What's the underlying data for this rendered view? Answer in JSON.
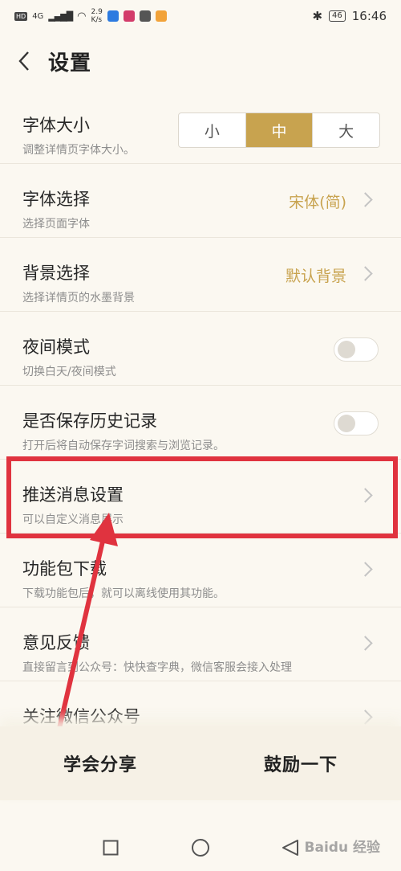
{
  "status_bar": {
    "network": "HD",
    "signal": "4G",
    "speed_value": "2.9",
    "speed_unit": "K/s",
    "battery": "46",
    "time": "16:46"
  },
  "header": {
    "title": "设置"
  },
  "settings": {
    "font_size": {
      "title": "字体大小",
      "subtitle": "调整详情页字体大小。",
      "options": [
        "小",
        "中",
        "大"
      ],
      "selected": "中"
    },
    "font_select": {
      "title": "字体选择",
      "subtitle": "选择页面字体",
      "value": "宋体(简)"
    },
    "background": {
      "title": "背景选择",
      "subtitle": "选择详情页的水墨背景",
      "value": "默认背景"
    },
    "night_mode": {
      "title": "夜间模式",
      "subtitle": "切换白天/夜间模式",
      "enabled": false
    },
    "history": {
      "title": "是否保存历史记录",
      "subtitle": "打开后将自动保存字词搜索与浏览记录。",
      "enabled": false
    },
    "push": {
      "title": "推送消息设置",
      "subtitle": "可以自定义消息展示"
    },
    "package": {
      "title": "功能包下载",
      "subtitle": "下载功能包后，就可以离线使用其功能。"
    },
    "feedback": {
      "title": "意见反馈",
      "subtitle": "直接留言到公众号：快快查字典，微信客服会接入处理"
    },
    "wechat": {
      "title": "关注微信公众号"
    }
  },
  "bottom": {
    "share_label": "学会分享",
    "encourage_label": "鼓励一下"
  },
  "watermark": "Baidu 经验",
  "colors": {
    "accent": "#c8a34f",
    "highlight": "#e0333f",
    "background": "#fbf8f1"
  }
}
